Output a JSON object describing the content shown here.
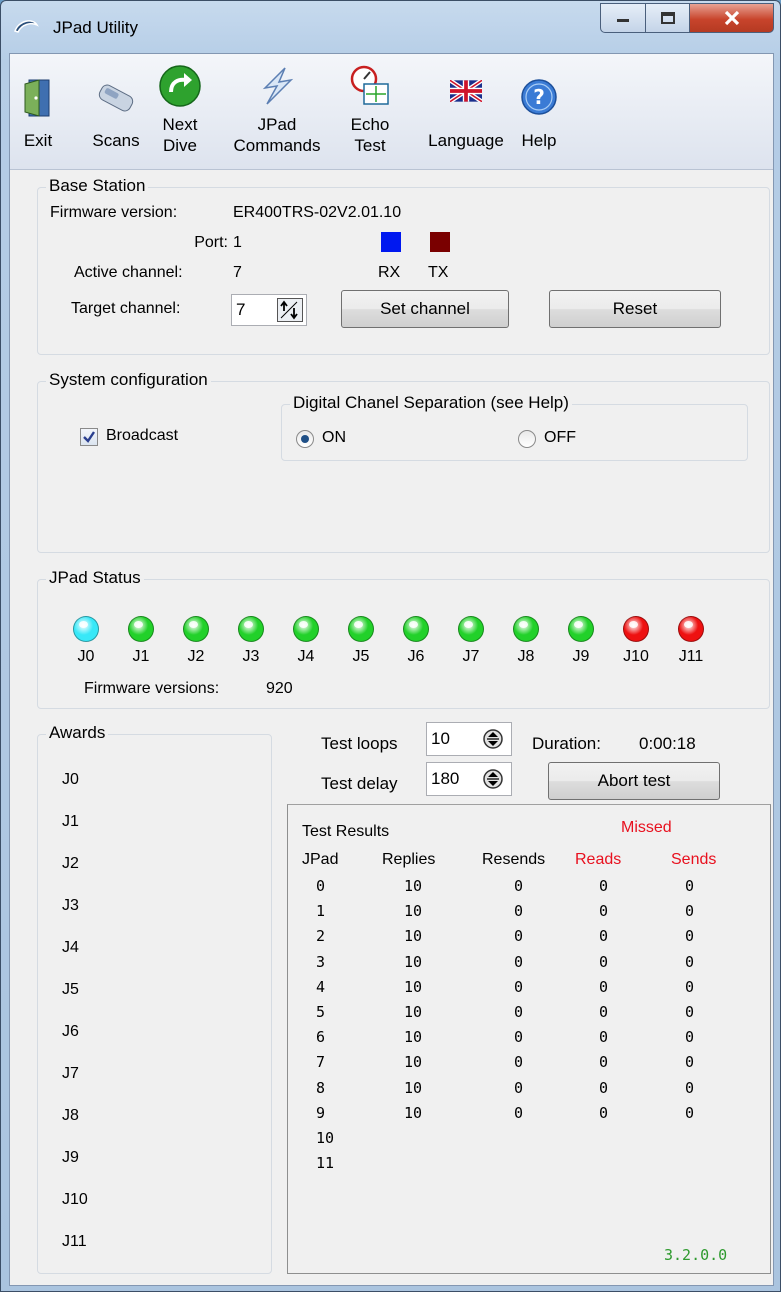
{
  "window": {
    "title": "JPad Utility",
    "colors": {
      "title_gradient": "#b5cde6",
      "close_red": "#c8442c",
      "frame_border": "#3b4e66"
    }
  },
  "toolbar": {
    "items": [
      {
        "label": "Exit",
        "icon": "exit-door-icon"
      },
      {
        "label": "Scans",
        "icon": "scan-device-icon"
      },
      {
        "label": "Next\nDive",
        "icon": "next-arrow-icon"
      },
      {
        "label": "JPad\nCommands",
        "icon": "lightning-bolt-icon"
      },
      {
        "label": "Echo\nTest",
        "icon": "gauge-echo-icon"
      },
      {
        "label": "Language",
        "icon": "uk-flag-icon"
      },
      {
        "label": "Help",
        "icon": "help-question-icon"
      }
    ]
  },
  "base_station": {
    "legend": "Base Station",
    "firmware_label": "Firmware version:",
    "firmware_value": "ER400TRS-02V2.01.10",
    "port_label": "Port:",
    "port_value": "1",
    "active_channel_label": "Active channel:",
    "active_channel_value": "7",
    "target_channel_label": "Target channel:",
    "target_channel_value": "7",
    "rx_label": "RX",
    "tx_label": "TX",
    "rx_color": "#0018f0",
    "tx_color": "#7a0000",
    "set_channel_label": "Set channel",
    "reset_label": "Reset"
  },
  "system_config": {
    "legend": "System configuration",
    "broadcast_label": "Broadcast",
    "broadcast_checked": true,
    "separation": {
      "legend": "Digital Chanel Separation (see Help)",
      "on_label": "ON",
      "off_label": "OFF",
      "selected": "ON"
    }
  },
  "jpad_status": {
    "legend": "JPad Status",
    "pads": [
      {
        "label": "J0",
        "color": "#38e8f8"
      },
      {
        "label": "J1",
        "color": "#22d12a"
      },
      {
        "label": "J2",
        "color": "#22d12a"
      },
      {
        "label": "J3",
        "color": "#22d12a"
      },
      {
        "label": "J4",
        "color": "#22d12a"
      },
      {
        "label": "J5",
        "color": "#22d12a"
      },
      {
        "label": "J6",
        "color": "#22d12a"
      },
      {
        "label": "J7",
        "color": "#22d12a"
      },
      {
        "label": "J8",
        "color": "#22d12a"
      },
      {
        "label": "J9",
        "color": "#22d12a"
      },
      {
        "label": "J10",
        "color": "#ee1111"
      },
      {
        "label": "J11",
        "color": "#ee1111"
      }
    ],
    "firmware_label": "Firmware versions:",
    "firmware_value": "920"
  },
  "awards": {
    "legend": "Awards",
    "items": [
      "J0",
      "J1",
      "J2",
      "J3",
      "J4",
      "J5",
      "J6",
      "J7",
      "J8",
      "J9",
      "J10",
      "J11"
    ]
  },
  "test": {
    "loops_label": "Test loops",
    "loops_value": "10",
    "delay_label": "Test delay",
    "delay_value": "180",
    "duration_label": "Duration:",
    "duration_value": "0:00:18",
    "abort_label": "Abort test"
  },
  "results": {
    "title": "Test Results",
    "missed_label": "Missed",
    "headers": {
      "jpad": "JPad",
      "replies": "Replies",
      "resends": "Resends",
      "reads": "Reads",
      "sends": "Sends"
    },
    "rows": [
      [
        "0",
        "10",
        "0",
        "0",
        "0"
      ],
      [
        "1",
        "10",
        "0",
        "0",
        "0"
      ],
      [
        "2",
        "10",
        "0",
        "0",
        "0"
      ],
      [
        "3",
        "10",
        "0",
        "0",
        "0"
      ],
      [
        "4",
        "10",
        "0",
        "0",
        "0"
      ],
      [
        "5",
        "10",
        "0",
        "0",
        "0"
      ],
      [
        "6",
        "10",
        "0",
        "0",
        "0"
      ],
      [
        "7",
        "10",
        "0",
        "0",
        "0"
      ],
      [
        "8",
        "10",
        "0",
        "0",
        "0"
      ],
      [
        "9",
        "10",
        "0",
        "0",
        "0"
      ],
      [
        "10",
        "",
        "",
        "",
        ""
      ],
      [
        "11",
        "",
        "",
        "",
        ""
      ]
    ],
    "missed_color": "#e8101e"
  },
  "version": {
    "text": "3.2.0.0",
    "color": "#2e9a2e"
  }
}
